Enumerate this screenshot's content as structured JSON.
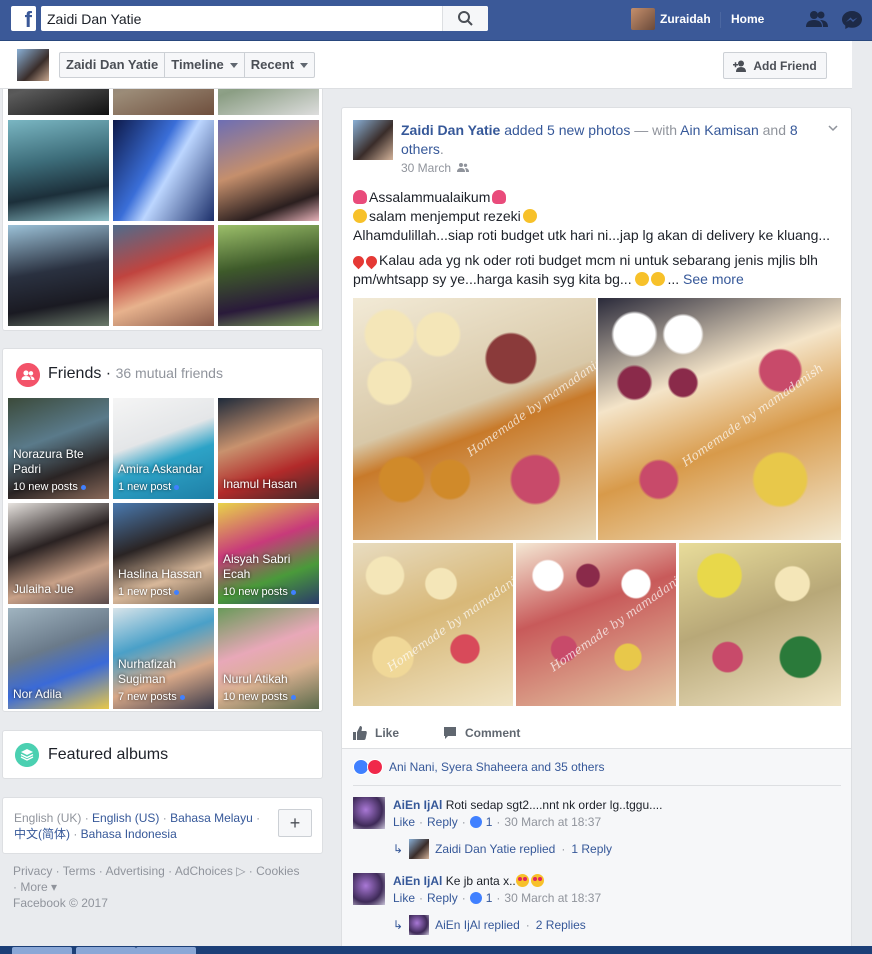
{
  "topbar": {
    "search_value": "Zaidi Dan Yatie",
    "user_name": "Zuraidah",
    "home_label": "Home"
  },
  "subnav": {
    "name": "Zaidi Dan Yatie",
    "timeline": "Timeline",
    "recent": "Recent",
    "add_friend": "Add Friend"
  },
  "friends": {
    "title": "Friends",
    "mutual": "36 mutual friends",
    "items": [
      {
        "name": "Norazura Bte Padri",
        "posts": "10 new posts"
      },
      {
        "name": "Amira Askandar",
        "posts": "1 new post"
      },
      {
        "name": "Inamul Hasan",
        "posts": ""
      },
      {
        "name": "Julaiha Jue",
        "posts": ""
      },
      {
        "name": "Haslina Hassan",
        "posts": "1 new post"
      },
      {
        "name": "Aisyah Sabri Ecah",
        "posts": "10 new posts"
      },
      {
        "name": "Nor Adila",
        "posts": ""
      },
      {
        "name": "Nurhafizah Sugiman",
        "posts": "7 new posts"
      },
      {
        "name": "Nurul Atikah",
        "posts": "10 new posts"
      }
    ]
  },
  "albums": {
    "title": "Featured albums"
  },
  "languages": {
    "current": "English (UK)",
    "links": [
      "English (US)",
      "Bahasa Melayu",
      "中文(简体)",
      "Bahasa Indonesia"
    ],
    "plus": "+"
  },
  "footer": {
    "line1": "Privacy · Terms · Advertising · AdChoices",
    "cookies": "· Cookies",
    "line2": "· More ▾",
    "copyright": "Facebook © 2017"
  },
  "post": {
    "author": "Zaidi Dan Yatie",
    "action": "added 5 new photos",
    "with": "— with",
    "tagged": "Ain Kamisan",
    "and_others": "and 8 others.",
    "and_word": "and",
    "others": "8 others",
    "time": "30 March",
    "line1": "Assalammualaikum",
    "line2": "salam menjemput rezeki",
    "line3": "Alhamdulillah...siap roti budget utk hari ni...jap lg akan di delivery ke kluang...",
    "line4": "Kalau ada yg nk oder roti budget mcm ni untuk sebarang jenis mjlis blh",
    "line5": "pm/whtsapp sy ye...harga kasih syg kita bg...",
    "see_more": "See more",
    "watermark": "Homemade by mamadanish",
    "like": "Like",
    "comment": "Comment",
    "reactions": "Ani Nani, Syera Shaheera and 35 others"
  },
  "comments": [
    {
      "author": "AiEn IjAl",
      "text": "Roti sedap sgt2....nnt nk order lg..tggu....",
      "like": "Like",
      "reply": "Reply",
      "count": "1",
      "time": "30 March at 18:37",
      "reply_author": "Zaidi Dan Yatie replied",
      "reply_count": "1 Reply"
    },
    {
      "author": "AiEn IjAl",
      "text": "Ke jb anta x..",
      "like": "Like",
      "reply": "Reply",
      "count": "1",
      "time": "30 March at 18:37",
      "reply_author": "AiEn IjAl replied",
      "reply_count": "2 Replies"
    }
  ],
  "colors": {
    "fb_blue": "#3b5998",
    "link": "#365899",
    "friends_icon": "#f35369",
    "albums_icon": "#4bd0b1"
  }
}
